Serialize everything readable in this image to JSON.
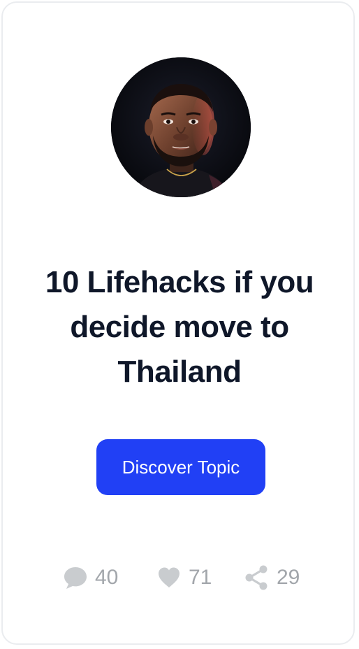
{
  "card": {
    "title": "10 Lifehacks if you decide move to Thailand",
    "cta_label": "Discover Topic",
    "accent_color": "#2140f5"
  },
  "stats": {
    "comments": "40",
    "likes": "71",
    "shares": "29"
  },
  "icons": {
    "comments": "speech-bubble",
    "likes": "heart",
    "shares": "share-nodes"
  }
}
